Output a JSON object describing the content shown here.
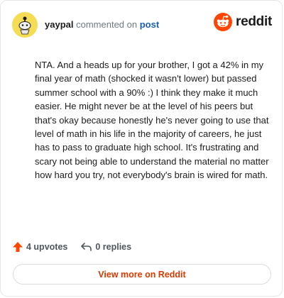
{
  "header": {
    "username": "yaypal",
    "action": "commented on",
    "target": "post",
    "avatar_icon": "snoo-avatar-icon",
    "avatar_color": "#f4dc55"
  },
  "brand": {
    "name": "reddit",
    "logo_icon": "reddit-logo-icon",
    "accent_color": "#ff4500"
  },
  "comment": {
    "body": "NTA. And a heads up for your brother, I got a 42% in my final year of math (shocked it wasn't lower) but passed summer school with a 90% :) I think they make it much easier. He might never be at the level of his peers but that's okay because honestly he's never going to use that level of math in his life in the majority of careers, he just has to pass to graduate high school. It's frustrating and scary not being able to understand the material no matter how hard you try, not everybody's brain is wired for math."
  },
  "footer": {
    "upvotes": "4 upvotes",
    "upvote_icon": "upvote-arrow-icon",
    "replies": "0 replies",
    "reply_icon": "reply-icon"
  },
  "view_more": {
    "label": "View more on Reddit",
    "color": "#d93a00"
  }
}
